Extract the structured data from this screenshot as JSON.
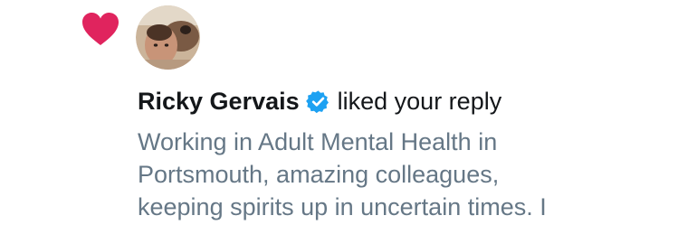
{
  "notification": {
    "icon": "heart-icon",
    "avatar_icon": "user-avatar-icon",
    "user_name": "Ricky Gervais",
    "verified_icon": "verified-badge-icon",
    "action_text": "liked your reply",
    "tweet_lines": [
      "Working in Adult Mental Health in",
      "Portsmouth, amazing colleagues,",
      "keeping spirits up in uncertain times. I"
    ]
  },
  "colors": {
    "heart": "#e0245e",
    "verified": "#1da1f2",
    "name_text": "#14171a",
    "tweet_text": "#657786",
    "background": "#ffffff"
  }
}
